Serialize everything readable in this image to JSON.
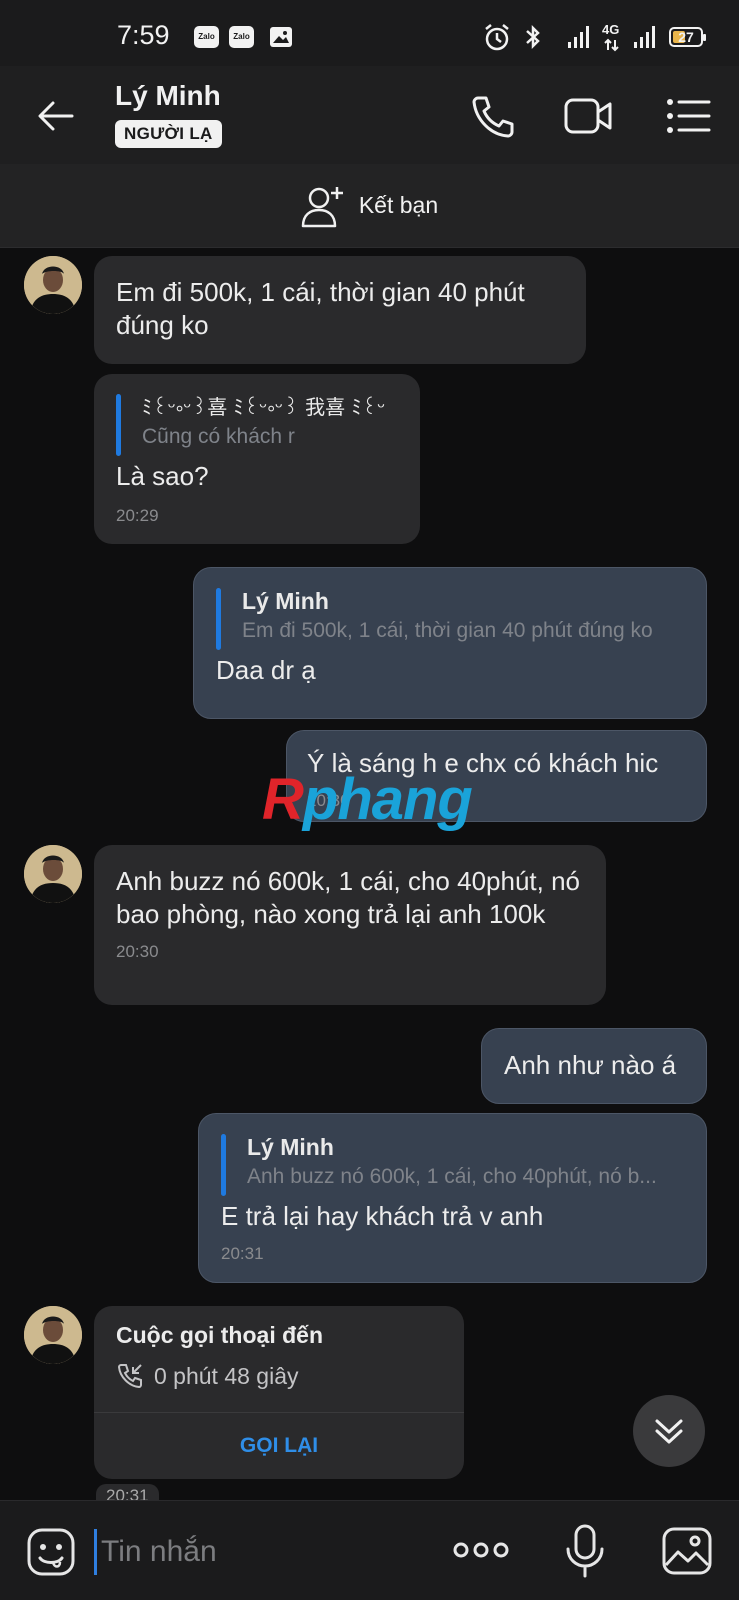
{
  "status_bar": {
    "time": "7:59",
    "app_icons": [
      "Zalo",
      "Zalo"
    ],
    "network": "4G",
    "battery": "27"
  },
  "header": {
    "contact_name": "Lý Minh",
    "badge": "NGƯỜI LẠ"
  },
  "friend_bar": {
    "label": "Kết bạn"
  },
  "messages": [
    {
      "side": "in",
      "text": "Em đi 500k, 1 cái, thời gian 40 phút đúng ko"
    },
    {
      "side": "in",
      "quote_name": "ﾐ꒰ᵕ༚ᵕ꒱喜 ﾐ꒰ᵕ༚ᵕ꒱ 我喜 ﾐ꒰ᵕ",
      "quote_text": "Cũng có khách r",
      "text": "Là sao?",
      "time": "20:29"
    },
    {
      "side": "out",
      "quote_name": "Lý Minh",
      "quote_text": "Em đi 500k, 1 cái, thời gian 40 phút đúng ko",
      "text": "Daa dr ạ"
    },
    {
      "side": "out",
      "text": "Ý là sáng h e chx có khách hic",
      "time": "20:30"
    },
    {
      "side": "in",
      "text": "Anh buzz nó 600k, 1 cái, cho 40phút, nó bao phòng, nào xong trả lại anh 100k",
      "time": "20:30"
    },
    {
      "side": "out",
      "text": "Anh như nào á"
    },
    {
      "side": "out",
      "quote_name": "Lý Minh",
      "quote_text": "Anh buzz nó 600k, 1 cái, cho 40phút, nó b...",
      "text": "E trả lại hay khách trả v anh",
      "time": "20:31"
    }
  ],
  "call": {
    "title": "Cuộc gọi thoại đến",
    "duration": "0 phút 48 giây",
    "action": "GỌI LẠI",
    "time": "20:31"
  },
  "watermark": {
    "r": "R",
    "rest": "phang"
  },
  "composer": {
    "placeholder": "Tin nhắn"
  },
  "colors": {
    "accent": "#1f7ae0",
    "outgoing_bubble": "#374150",
    "incoming_bubble": "#2a2a2c"
  }
}
